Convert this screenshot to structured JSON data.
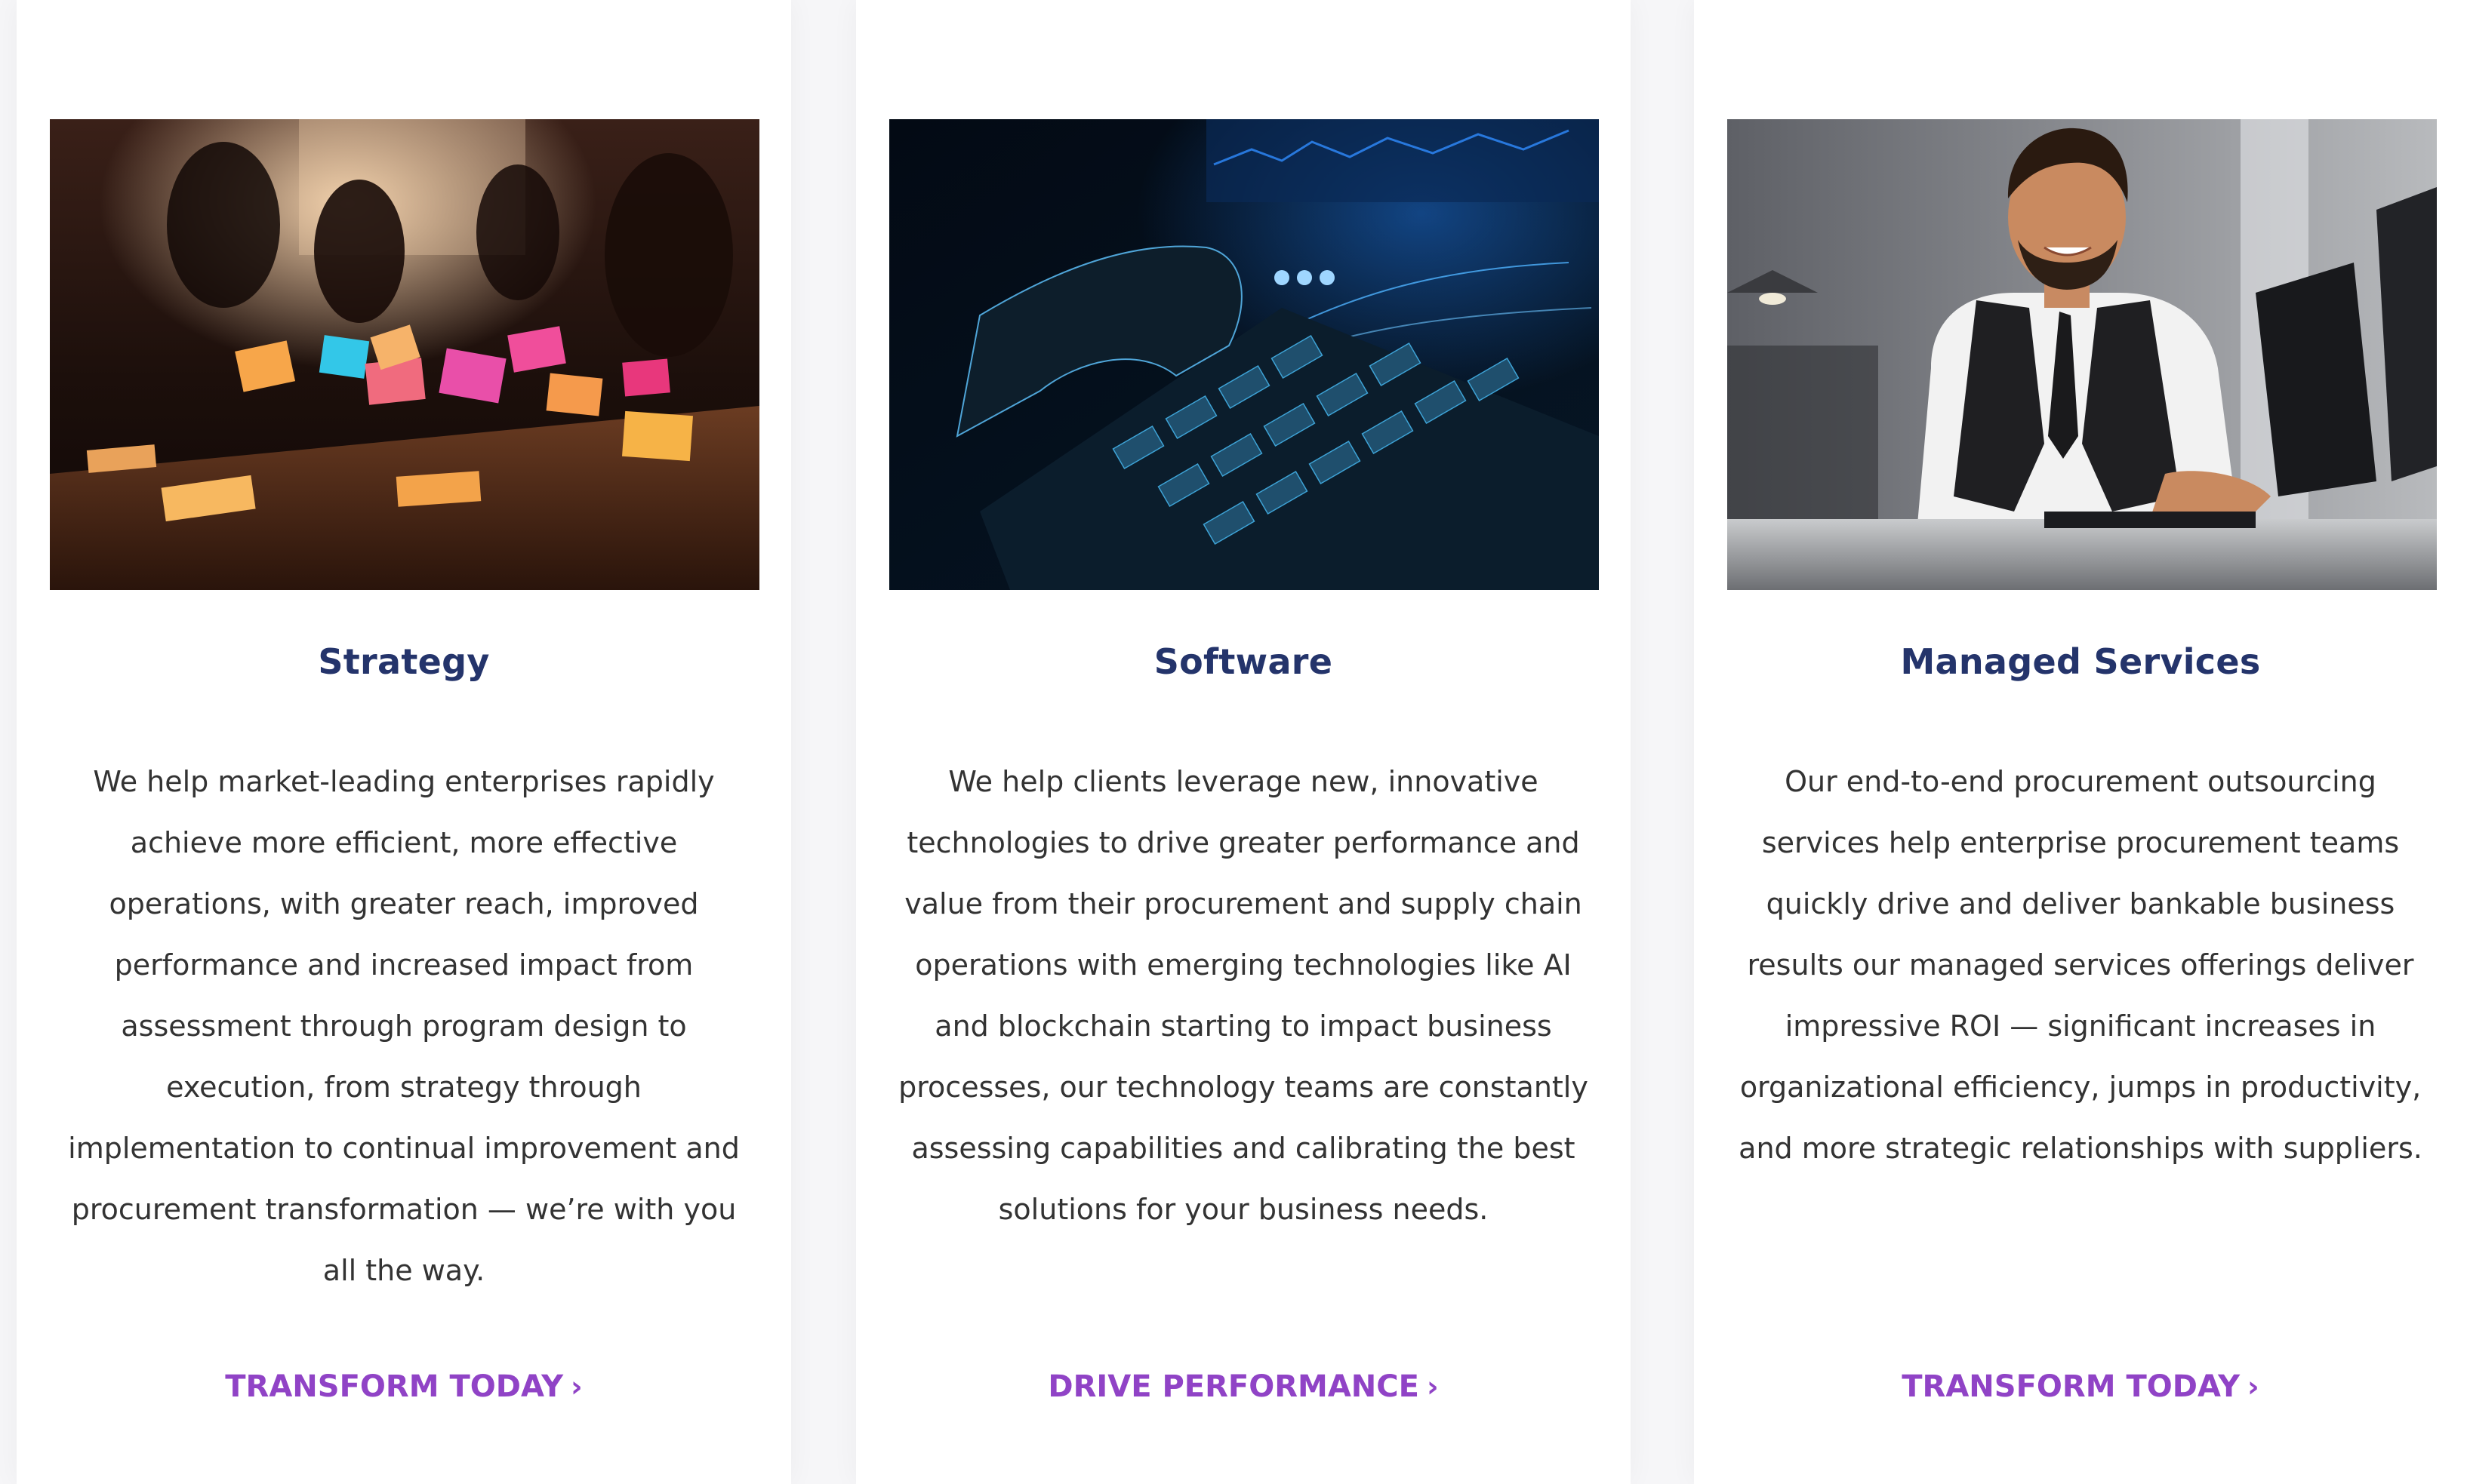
{
  "cards": [
    {
      "title": "Strategy",
      "description": "We help market-leading enterprises rapidly achieve more efficient, more effective operations, with greater reach, improved performance and increased impact from assessment through program design to execution, from strategy through implementation to continual improvement and procurement transformation — we’re with you all the way.",
      "cta_label": "TRANSFORM TODAY",
      "cta_icon": "chevron-right-icon"
    },
    {
      "title": "Software",
      "description": "We help clients leverage new, innovative technologies to drive greater performance and value from their procurement and supply chain operations with emerging technologies like AI and blockchain starting to impact business processes, our technology teams are constantly assessing capabilities and calibrating the best solutions for your business needs.",
      "cta_label": "DRIVE PERFORMANCE",
      "cta_icon": "chevron-right-icon"
    },
    {
      "title": "Managed Services",
      "description": "Our end-to-end procurement outsourcing services help enterprise procurement teams quickly drive and deliver bankable business results our managed services offerings deliver impressive ROI — significant increases in organizational efficiency, jumps in productivity, and more strategic relationships with suppliers.",
      "cta_label": "TRANSFORM TODAY",
      "cta_icon": "chevron-right-icon"
    }
  ],
  "colors": {
    "title": "#24346b",
    "body_text": "#333333",
    "cta": "#9043c6",
    "card_bg": "#ffffff",
    "page_bg": "#f6f6f8"
  }
}
